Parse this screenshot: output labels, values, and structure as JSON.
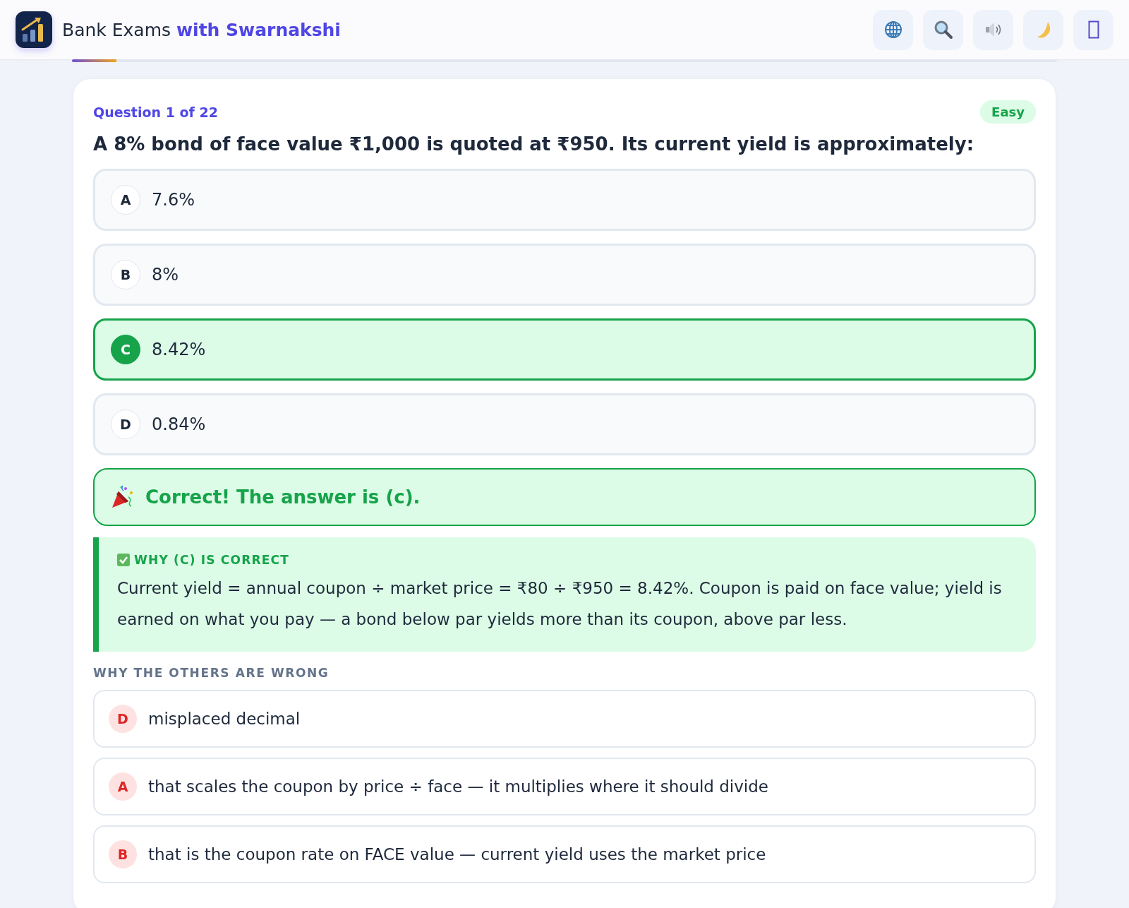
{
  "header": {
    "brand": "Bank Exams",
    "brand_accent": "with Swarnakshi",
    "buttons": [
      {
        "kind": "globe"
      },
      {
        "kind": "search"
      },
      {
        "kind": "sound"
      },
      {
        "kind": "moon"
      },
      {
        "kind": "missing"
      }
    ]
  },
  "progress": {
    "level": 0.045
  },
  "question": {
    "counter": "Question 1 of 22",
    "difficulty": "Easy",
    "text": "A 8% bond of face value ₹1,000 is quoted at ₹950. Its current yield is approximately:",
    "options": [
      {
        "letter": "A",
        "text": "7.6%",
        "selected": false
      },
      {
        "letter": "B",
        "text": "8%",
        "selected": false
      },
      {
        "letter": "C",
        "text": "8.42%",
        "selected": true
      },
      {
        "letter": "D",
        "text": "0.84%",
        "selected": false
      }
    ]
  },
  "feedback": {
    "message": "Correct! The answer is (c)."
  },
  "explanation": {
    "title": "WHY (C) IS CORRECT",
    "text": "Current yield = annual coupon ÷ market price = ₹80 ÷ ₹950 = 8.42%. Coupon is paid on face value; yield is earned on what you pay — a bond below par yields more than its coupon, above par less."
  },
  "others": {
    "title": "WHY THE OTHERS ARE WRONG",
    "items": [
      {
        "letter": "D",
        "text": "misplaced decimal"
      },
      {
        "letter": "A",
        "text": "that scales the coupon by price ÷ face — it multiplies where it should divide"
      },
      {
        "letter": "B",
        "text": "that is the coupon rate on FACE value — current yield uses the market price"
      }
    ]
  }
}
